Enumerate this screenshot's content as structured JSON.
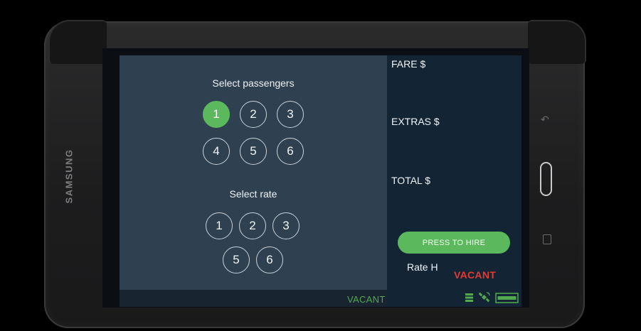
{
  "device": {
    "brand": "SAMSUNG"
  },
  "passengers": {
    "title": "Select passengers",
    "options": [
      "1",
      "2",
      "3",
      "4",
      "5",
      "6"
    ],
    "selected": "1"
  },
  "rate": {
    "title": "Select rate",
    "options": [
      "1",
      "2",
      "3",
      "5",
      "6"
    ]
  },
  "meter": {
    "fare_label": "FARE $",
    "extras_label": "EXTRAS $",
    "total_label": "TOTAL $"
  },
  "hire_button": "PRESS TO HIRE",
  "rate_status": "Rate H",
  "status": {
    "vacant_top": "VACANT",
    "vacant_bottom": "VACANT"
  },
  "icons": [
    "server-icon",
    "satellite-icon",
    "printer-icon"
  ],
  "colors": {
    "accent_green": "#5cb85c",
    "vacant_red": "#e4392f",
    "panel_left": "#2f4050",
    "panel_right": "#132435"
  }
}
